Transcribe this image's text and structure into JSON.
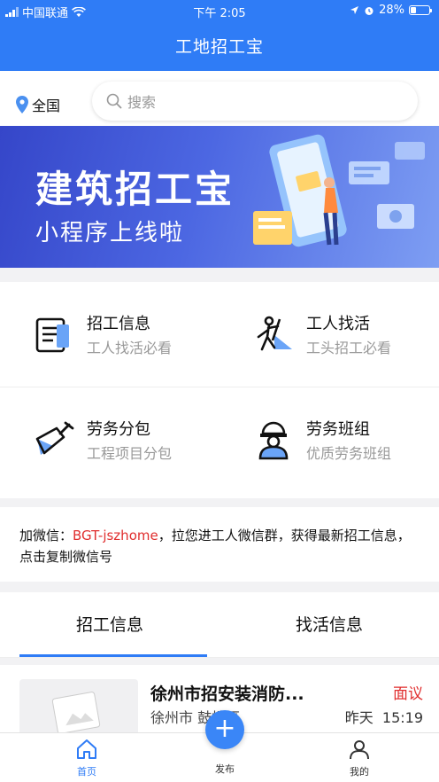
{
  "status_bar": {
    "carrier": "中国联通",
    "time": "下午 2:05",
    "battery": "28%",
    "battery_level": 0.28
  },
  "app": {
    "title": "工地招工宝"
  },
  "search": {
    "location": "全国",
    "placeholder": "搜索"
  },
  "banner": {
    "headline": "建筑招工宝",
    "subline": "小程序上线啦"
  },
  "menu": [
    {
      "title": "招工信息",
      "subtitle": "工人找活必看",
      "icon": "document-list-icon"
    },
    {
      "title": "工人找活",
      "subtitle": "工头招工必看",
      "icon": "worker-digging-icon"
    },
    {
      "title": "劳务分包",
      "subtitle": "工程项目分包",
      "icon": "trowel-icon"
    },
    {
      "title": "劳务班组",
      "subtitle": "优质劳务班组",
      "icon": "hardhat-worker-icon"
    }
  ],
  "wechat": {
    "prefix": "加微信：",
    "id": "BGT-jszhome",
    "suffix": "，拉您进工人微信群，获得最新招工信息，点击复制微信号"
  },
  "tabs": [
    {
      "label": "招工信息",
      "active": true
    },
    {
      "label": "找活信息",
      "active": false
    }
  ],
  "job": {
    "title": "徐州市招安装消防...",
    "location": "徐州市 鼓楼区",
    "price": "面议",
    "date": "昨天",
    "time": "15:19"
  },
  "bottom_nav": [
    {
      "label": "首页",
      "active": true,
      "icon": "home-icon"
    },
    {
      "label": "发布",
      "active": false,
      "icon": "plus-icon"
    },
    {
      "label": "我的",
      "active": false,
      "icon": "user-icon"
    }
  ],
  "colors": {
    "primary": "#2f7cf6",
    "accent_red": "#e02e2e"
  }
}
